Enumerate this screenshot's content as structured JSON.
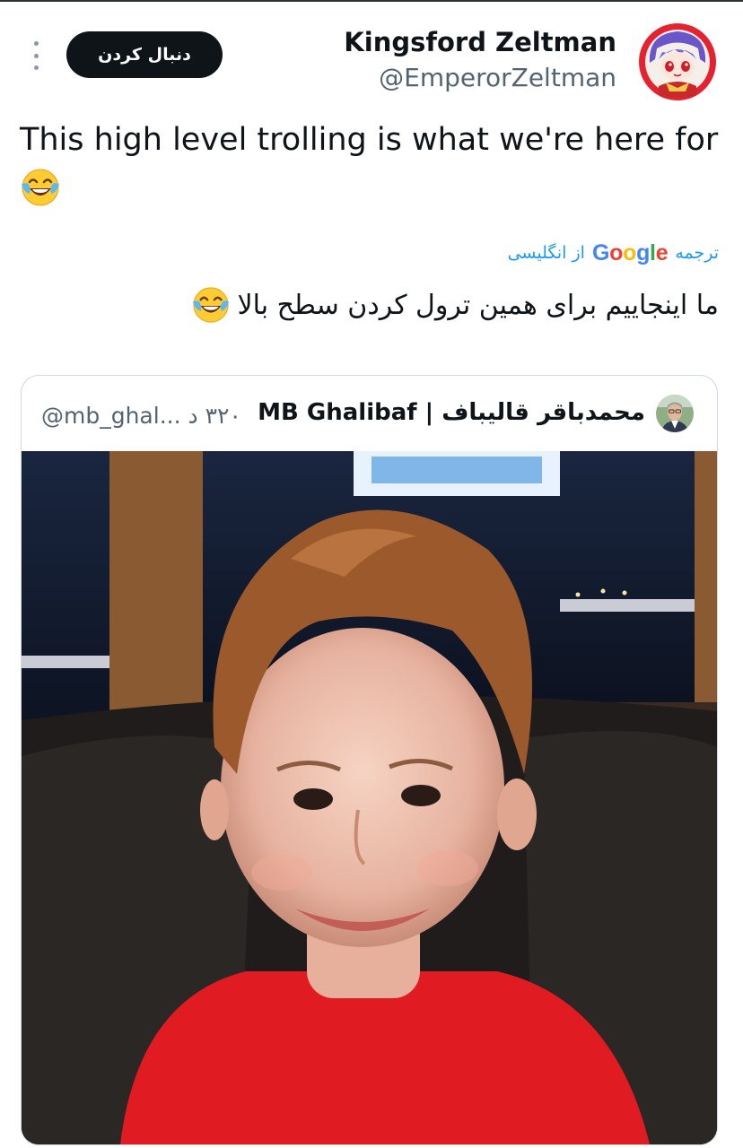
{
  "tweet": {
    "author_name": "Kingsford Zeltman",
    "author_handle": "@EmperorZeltman",
    "follow_label": "دنبال کردن",
    "text": "This high level trolling is what we're here for",
    "emoji": "face-with-tears-of-joy"
  },
  "translation": {
    "translate_label": "ترجمه",
    "provider": "Google",
    "from_label": "از انگلیسی",
    "text": "ما اینجاییم برای همین ترول کردن سطح بالا"
  },
  "quoted_tweet": {
    "author_name": "محمدباقر قالیباف | MB Ghalibaf",
    "author_handle": "@mb_ghal...",
    "timestamp": "۳۲۰ د",
    "media": "photo-of-smiling-boy-in-red-shirt"
  },
  "colors": {
    "text": "#0f1419",
    "secondary_text": "#536471",
    "link": "#1d9bf0",
    "button_bg": "#0f1419",
    "border": "#cfd9de"
  }
}
